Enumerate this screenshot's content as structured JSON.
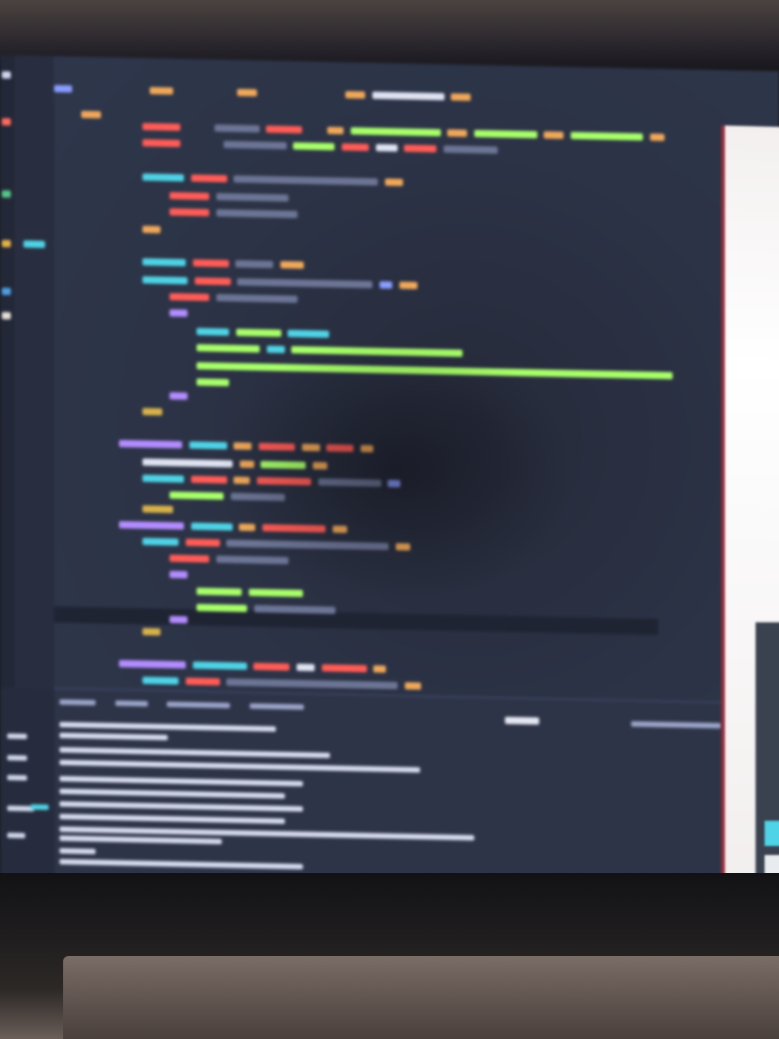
{
  "editor": {
    "theme": "dark",
    "colors": {
      "background": "#2c3346",
      "keyword": "#ff5c57",
      "function": "#4fd3e6",
      "string": "#a8ff6a",
      "number": "#f0a85a",
      "bracket": "#b38cff"
    }
  },
  "terminal": {
    "background": "#2e3448"
  },
  "side_window": {
    "accent": "#9a2f3d"
  },
  "icons": [
    "files-icon",
    "search-icon",
    "source-control-icon",
    "run-debug-icon",
    "extensions-icon"
  ]
}
